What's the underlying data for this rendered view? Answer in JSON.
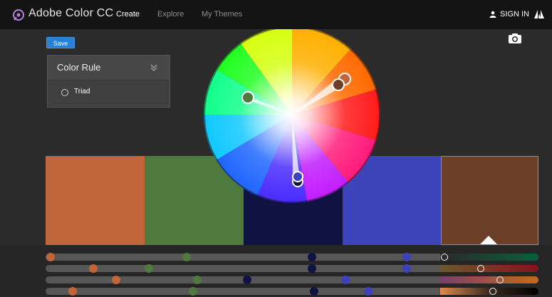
{
  "header": {
    "brand": "Adobe Color CC",
    "nav": [
      "Create",
      "Explore",
      "My Themes"
    ],
    "signin": "SIGN IN",
    "icons": {
      "logo": "adobe-color-logo",
      "user": "user-icon",
      "adobe": "adobe-icon"
    }
  },
  "toolbar": {
    "save_label": "Save",
    "camera_icon": "camera-icon"
  },
  "color_rule": {
    "title": "Color Rule",
    "option": "Triad"
  },
  "swatches": [
    {
      "color": "#c0663a"
    },
    {
      "color": "#4e7a3d"
    },
    {
      "color": "#101342"
    },
    {
      "color": "#3d43b8"
    },
    {
      "color": "#6c4028",
      "selected": true
    }
  ],
  "colors": {
    "accent": "#2b7fd3",
    "background": "#2b2b2b",
    "topbar": "#141414"
  }
}
